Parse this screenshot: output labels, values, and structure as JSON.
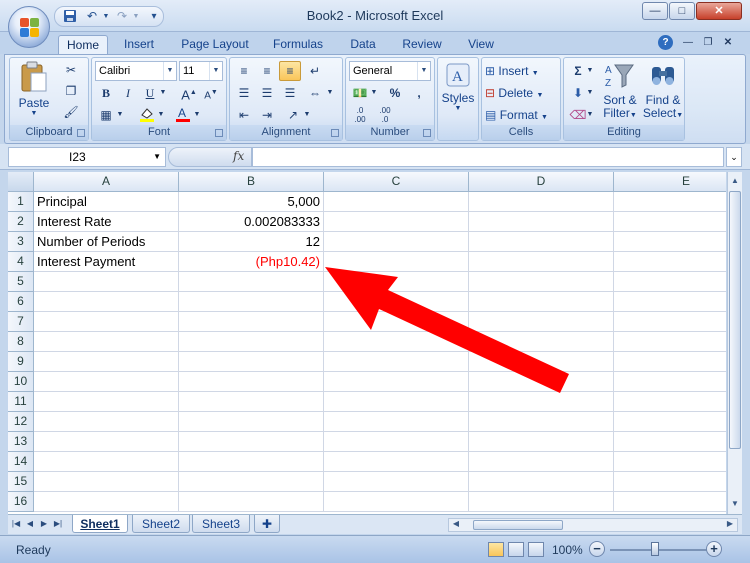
{
  "window": {
    "title": "Book2 - Microsoft Excel"
  },
  "tabs": [
    "Home",
    "Insert",
    "Page Layout",
    "Formulas",
    "Data",
    "Review",
    "View"
  ],
  "ribbon": {
    "clipboard": {
      "label": "Clipboard",
      "paste_label": "Paste"
    },
    "font": {
      "label": "Font",
      "font_name": "Calibri",
      "font_size": "11"
    },
    "alignment": {
      "label": "Alignment"
    },
    "number": {
      "label": "Number",
      "format": "General"
    },
    "styles": {
      "label": "Styles"
    },
    "cells": {
      "label": "Cells",
      "insert_label": "Insert",
      "delete_label": "Delete",
      "format_label": "Format"
    },
    "editing": {
      "label": "Editing",
      "sort_label_1": "Sort &",
      "sort_label_2": "Filter",
      "find_label_1": "Find &",
      "find_label_2": "Select"
    }
  },
  "formula_bar": {
    "name_box": "I23",
    "fx_label": "fx",
    "content": ""
  },
  "grid": {
    "columns": [
      "A",
      "B",
      "C",
      "D",
      "E"
    ],
    "rows": [
      "1",
      "2",
      "3",
      "4",
      "5",
      "6",
      "7",
      "8",
      "9",
      "10",
      "11",
      "12",
      "13",
      "14",
      "15",
      "16"
    ],
    "cells": {
      "A1": "Principal",
      "B1": "5,000",
      "A2": "Interest Rate",
      "B2": "0.002083333",
      "A3": "Number of Periods",
      "B3": "12",
      "A4": "Interest Payment",
      "B4": "(Php10.42)"
    },
    "negative_color": "#ff0000"
  },
  "sheets": {
    "tabs": [
      "Sheet1",
      "Sheet2",
      "Sheet3"
    ],
    "active": "Sheet1"
  },
  "status": {
    "text": "Ready",
    "zoom": "100%"
  },
  "annotation": {
    "arrow_color": "#ff0000"
  },
  "colors": {
    "ribbon_bg": "#dce8f6",
    "accent": "#15428b"
  }
}
